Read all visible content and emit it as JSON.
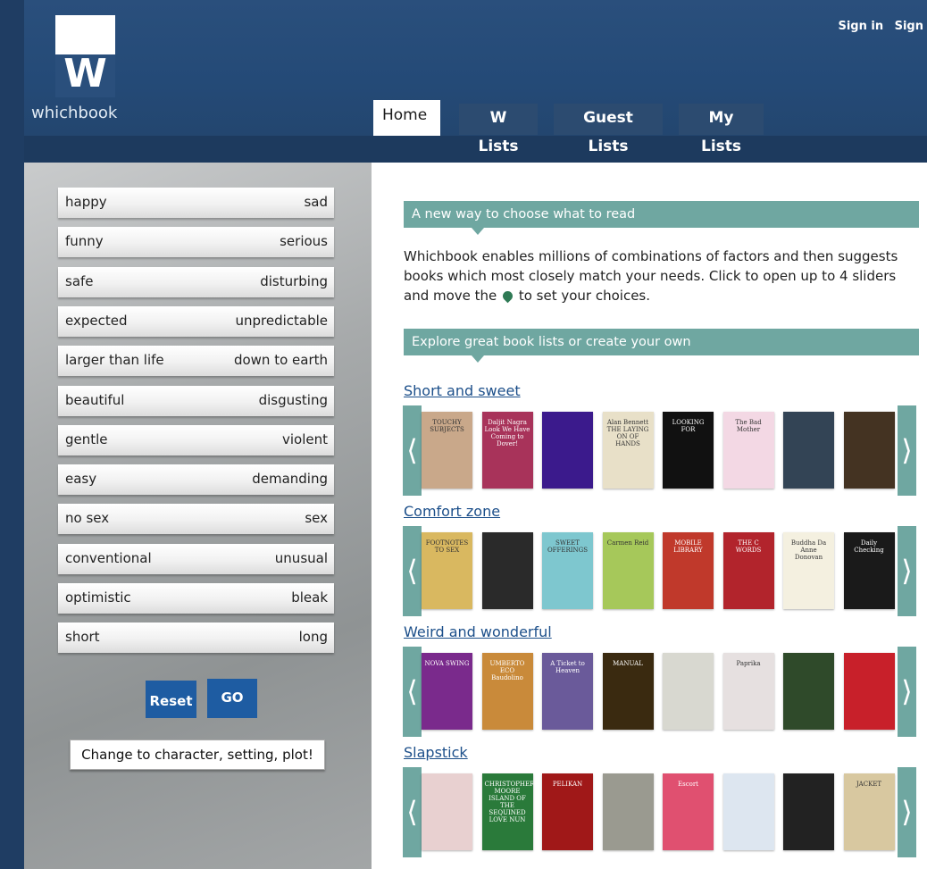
{
  "brand": {
    "logo_letter": "W",
    "name": "whichbook"
  },
  "auth": {
    "sign_in": "Sign in",
    "sign_up": "Sign"
  },
  "tabs": [
    {
      "label": "Home"
    },
    {
      "label": "W Lists"
    },
    {
      "label": "Guest Lists"
    },
    {
      "label": "My Lists"
    }
  ],
  "sliders": [
    {
      "left": "happy",
      "right": "sad"
    },
    {
      "left": "funny",
      "right": "serious"
    },
    {
      "left": "safe",
      "right": "disturbing"
    },
    {
      "left": "expected",
      "right": "unpredictable"
    },
    {
      "left": "larger than life",
      "right": "down to earth"
    },
    {
      "left": "beautiful",
      "right": "disgusting"
    },
    {
      "left": "gentle",
      "right": "violent"
    },
    {
      "left": "easy",
      "right": "demanding"
    },
    {
      "left": "no sex",
      "right": "sex"
    },
    {
      "left": "conventional",
      "right": "unusual"
    },
    {
      "left": "optimistic",
      "right": "bleak"
    },
    {
      "left": "short",
      "right": "long"
    }
  ],
  "buttons": {
    "reset": "Reset",
    "go": "GO",
    "change": "Change to character, setting, plot!"
  },
  "banners": {
    "choose": "A new way to choose what to read",
    "explore": "Explore great book lists or create your own"
  },
  "intro": {
    "part1": "Whichbook enables millions of combinations of factors and then suggests books which most closely match your needs. Click to open up to 4 sliders and move the",
    "part2": "to set your choices."
  },
  "lists": [
    {
      "title": "Short and sweet",
      "covers": [
        {
          "color": "#c9a88a",
          "text": "TOUCHY SUBJECTS"
        },
        {
          "color": "#a8335a",
          "text": "Daljit Nagra Look We Have Coming to Dover!"
        },
        {
          "color": "#3b1a8c",
          "text": ""
        },
        {
          "color": "#e8e0c8",
          "text": "Alan Bennett THE LAYING ON OF HANDS"
        },
        {
          "color": "#111111",
          "text": "LOOKING FOR"
        },
        {
          "color": "#f3d8e4",
          "text": "The Bad Mother"
        },
        {
          "color": "#334455",
          "text": ""
        },
        {
          "color": "#443322",
          "text": ""
        }
      ]
    },
    {
      "title": "Comfort zone",
      "covers": [
        {
          "color": "#d9b860",
          "text": "FOOTNOTES TO SEX"
        },
        {
          "color": "#2a2a2a",
          "text": ""
        },
        {
          "color": "#7ec7cf",
          "text": "SWEET OFFERINGS"
        },
        {
          "color": "#a6c85a",
          "text": "Carmen Reid"
        },
        {
          "color": "#c0392b",
          "text": "MOBILE LIBRARY"
        },
        {
          "color": "#b2242c",
          "text": "THE C WORDS"
        },
        {
          "color": "#f4f0e0",
          "text": "Buddha Da Anne Donovan"
        },
        {
          "color": "#1a1a1a",
          "text": "Daily Checking"
        }
      ]
    },
    {
      "title": "Weird and wonderful",
      "covers": [
        {
          "color": "#7a2a8c",
          "text": "NOVA SWING"
        },
        {
          "color": "#c98a3a",
          "text": "UMBERTO ECO Baudolino"
        },
        {
          "color": "#6a5a9a",
          "text": "A Ticket to Heaven"
        },
        {
          "color": "#3a2a10",
          "text": "MANUAL"
        },
        {
          "color": "#d8d8d0",
          "text": ""
        },
        {
          "color": "#e6e0e0",
          "text": "Paprika"
        },
        {
          "color": "#2f4a2a",
          "text": ""
        },
        {
          "color": "#c8202a",
          "text": ""
        }
      ]
    },
    {
      "title": "Slapstick",
      "covers": [
        {
          "color": "#e8d0d0",
          "text": ""
        },
        {
          "color": "#2a7a3a",
          "text": "CHRISTOPHER MOORE ISLAND OF THE SEQUINED LOVE NUN"
        },
        {
          "color": "#a01818",
          "text": "PELIKAN"
        },
        {
          "color": "#9a9a90",
          "text": ""
        },
        {
          "color": "#e05070",
          "text": "Escort"
        },
        {
          "color": "#dde6f0",
          "text": ""
        },
        {
          "color": "#222222",
          "text": ""
        },
        {
          "color": "#d8c8a0",
          "text": "JACKET"
        }
      ]
    }
  ]
}
